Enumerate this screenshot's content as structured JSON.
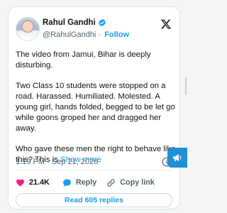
{
  "author": {
    "name": "Rahul Gandhi",
    "handle": "@RahulGandhi",
    "separator": "·",
    "follow_label": "Follow"
  },
  "icons": {
    "verified": "verified-badge-icon",
    "platform": "x-logo-icon",
    "info": "info-icon",
    "floating": "megaphone-icon"
  },
  "tweet": {
    "paragraphs": [
      "The video from Jamui, Bihar is deeply disturbing.",
      "Two Class 10 students were stopped on a road. Harassed. Humiliated. Molested. A young girl, hands folded, begged to be let go while goons groped her and dragged her away."
    ],
    "last_paragraph": "Who gave these men the right to behave like this? This is",
    "show_more": "Show more"
  },
  "meta": {
    "time": "1:19 PM",
    "separator": "·",
    "date": "Sep 21, 2026"
  },
  "actions": {
    "likes": "21.4K",
    "reply_label": "Reply",
    "copy_label": "Copy link"
  },
  "read_replies": "Read 605 replies",
  "colors": {
    "accent": "#1d9bf0",
    "like": "#f91880",
    "text": "#0f1419",
    "secondary": "#536471",
    "floating_button": "#1f8fd6"
  }
}
